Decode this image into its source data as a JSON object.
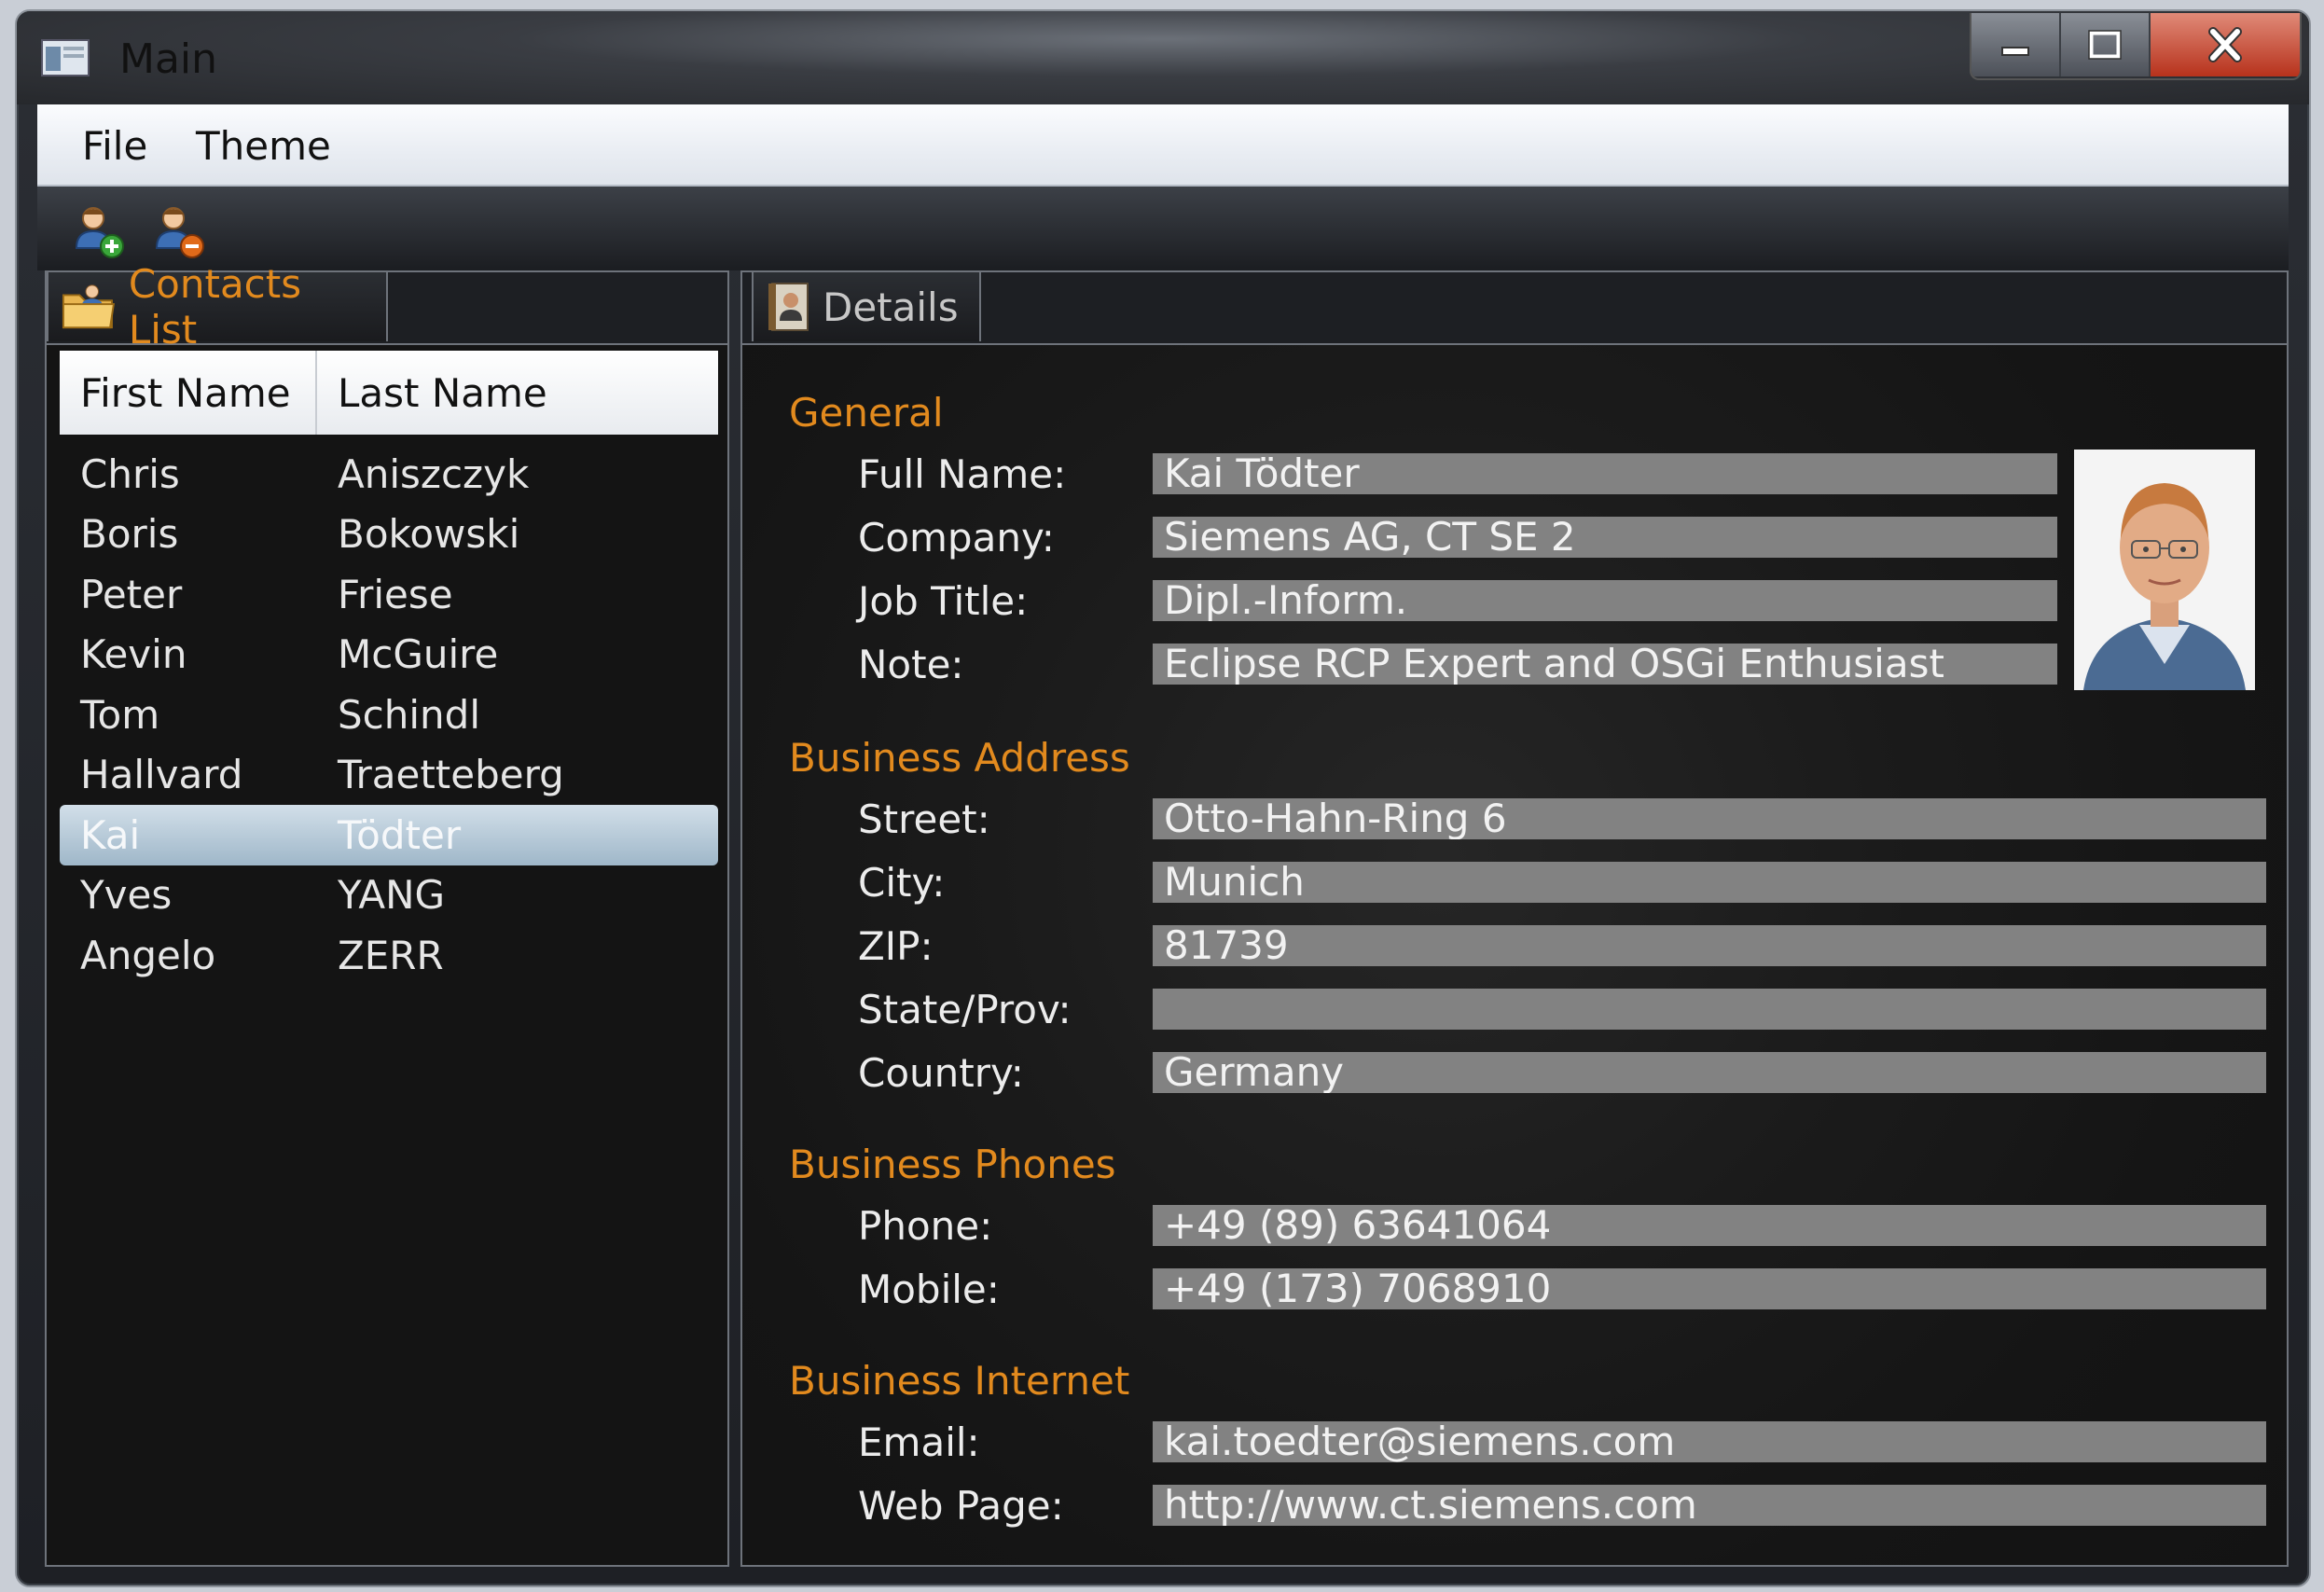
{
  "window": {
    "title": "Main",
    "icon": "app-window-icon"
  },
  "caption_buttons": {
    "minimize": "minimize-icon",
    "maximize": "maximize-icon",
    "close": "close-icon"
  },
  "menu": [
    {
      "label": "File"
    },
    {
      "label": "Theme"
    }
  ],
  "toolbar": {
    "add_contact_icon": "add-contact-icon",
    "delete_contact_icon": "delete-contact-icon"
  },
  "contacts": {
    "tab_label": "Contacts List",
    "columns": [
      "First Name",
      "Last Name"
    ],
    "rows": [
      [
        "Chris",
        "Aniszczyk"
      ],
      [
        "Boris",
        "Bokowski"
      ],
      [
        "Peter",
        "Friese"
      ],
      [
        "Kevin",
        "McGuire"
      ],
      [
        "Tom",
        "Schindl"
      ],
      [
        "Hallvard",
        "Traetteberg"
      ],
      [
        "Kai",
        "Tödter"
      ],
      [
        "Yves",
        "YANG"
      ],
      [
        "Angelo",
        "ZERR"
      ]
    ],
    "selected_index": 6
  },
  "details": {
    "tab_label": "Details",
    "general": {
      "heading": "General",
      "full_name_label": "Full Name:",
      "full_name": "Kai Tödter",
      "company_label": "Company:",
      "company": "Siemens AG, CT SE 2",
      "job_title_label": "Job Title:",
      "job_title": "Dipl.-Inform.",
      "note_label": "Note:",
      "note": "Eclipse RCP Expert and OSGi Enthusiast"
    },
    "address": {
      "heading": "Business Address",
      "street_label": "Street:",
      "street": "Otto-Hahn-Ring 6",
      "city_label": "City:",
      "city": "Munich",
      "zip_label": "ZIP:",
      "zip": "81739",
      "state_label": "State/Prov:",
      "state": "",
      "country_label": "Country:",
      "country": "Germany"
    },
    "phones": {
      "heading": "Business Phones",
      "phone_label": "Phone:",
      "phone": "+49 (89) 63641064",
      "mobile_label": "Mobile:",
      "mobile": "+49 (173) 7068910"
    },
    "internet": {
      "heading": "Business Internet",
      "email_label": "Email:",
      "email": "kai.toedter@siemens.com",
      "web_label": "Web Page:",
      "web": "http://www.ct.siemens.com"
    }
  },
  "colors": {
    "accent": "#e28a1e",
    "field_bg": "#828282",
    "selection": "#b8ccdb"
  }
}
